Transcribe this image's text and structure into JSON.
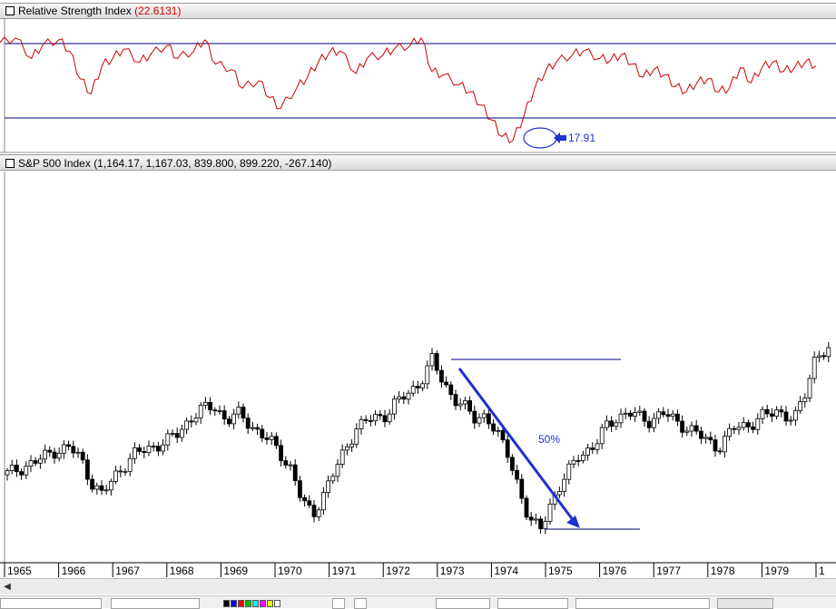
{
  "colors": {
    "rsi_line": "#cc0000",
    "reference_line": "#000080",
    "annotation": "#1f2fd0",
    "candle": "#000000",
    "rsi_value_text": "#d00000"
  },
  "rsi_pane": {
    "title": "Relative Strength Index",
    "value": "(22.6131)",
    "low_callout": "17.91"
  },
  "price_pane": {
    "title": "S&P 500 Index",
    "ohlc": "(1,164.17, 1,167.03, 839.800, 899.220, -267.140)",
    "annotation": "50%"
  },
  "x_axis": {
    "labels": [
      "1965",
      "1966",
      "1967",
      "1968",
      "1969",
      "1970",
      "1971",
      "1972",
      "1973",
      "1974",
      "1975",
      "1976",
      "1977",
      "1978",
      "1979",
      "1"
    ]
  },
  "chart_data": [
    {
      "type": "line",
      "title": "Relative Strength Index",
      "x_range": [
        1965,
        1980
      ],
      "reference_levels": [
        70,
        30
      ],
      "min_marked": 17.91,
      "series": [
        {
          "name": "Relative Strength Index",
          "x": [
            1964.9,
            1965.2,
            1965.5,
            1965.7,
            1966.0,
            1966.2,
            1966.4,
            1966.6,
            1966.8,
            1967.0,
            1967.2,
            1967.5,
            1967.7,
            1968.0,
            1968.2,
            1968.5,
            1968.7,
            1968.9,
            1969.2,
            1969.4,
            1969.7,
            1969.9,
            1970.1,
            1970.4,
            1970.6,
            1970.8,
            1971.0,
            1971.2,
            1971.5,
            1971.7,
            1972.0,
            1972.2,
            1972.5,
            1972.7,
            1972.9,
            1973.1,
            1973.4,
            1973.6,
            1973.8,
            1974.0,
            1974.2,
            1974.4,
            1974.6,
            1974.8,
            1975.0,
            1975.2,
            1975.5,
            1975.7,
            1976.0,
            1976.2,
            1976.4,
            1976.6,
            1976.8,
            1977.0,
            1977.2,
            1977.4,
            1977.6,
            1977.8,
            1978.0,
            1978.2,
            1978.4,
            1978.6,
            1978.8,
            1979.0,
            1979.2,
            1979.4,
            1979.6,
            1979.8,
            1980.0
          ],
          "values": [
            70,
            73,
            62,
            69,
            72,
            66,
            51,
            43,
            58,
            62,
            67,
            60,
            64,
            69,
            62,
            66,
            72,
            59,
            56,
            46,
            50,
            41,
            35,
            46,
            52,
            60,
            65,
            66,
            54,
            62,
            64,
            67,
            69,
            73,
            55,
            53,
            48,
            44,
            37,
            29,
            20,
            18,
            31,
            46,
            55,
            60,
            64,
            66,
            62,
            61,
            64,
            59,
            52,
            56,
            53,
            47,
            44,
            49,
            51,
            44,
            46,
            57,
            49,
            57,
            60,
            55,
            57,
            60,
            58
          ]
        }
      ]
    },
    {
      "type": "candlestick",
      "title": "S&P 500 Index",
      "x_range": [
        1965,
        1980
      ],
      "y_range": [
        60,
        125
      ],
      "series": [
        {
          "name": "S&P 500 Index",
          "x": [
            1965.0,
            1965.3,
            1965.6,
            1965.9,
            1966.2,
            1966.4,
            1966.6,
            1966.8,
            1967.1,
            1967.4,
            1967.7,
            1968.0,
            1968.2,
            1968.4,
            1968.6,
            1968.9,
            1969.1,
            1969.3,
            1969.6,
            1969.9,
            1970.1,
            1970.3,
            1970.5,
            1970.7,
            1971.0,
            1971.2,
            1971.5,
            1971.7,
            1972.0,
            1972.2,
            1972.5,
            1972.7,
            1972.9,
            1973.1,
            1973.3,
            1973.5,
            1973.7,
            1973.9,
            1974.1,
            1974.3,
            1974.5,
            1974.7,
            1974.9,
            1975.1,
            1975.4,
            1975.6,
            1975.9,
            1976.1,
            1976.3,
            1976.6,
            1976.9,
            1977.2,
            1977.5,
            1977.8,
            1978.0,
            1978.2,
            1978.5,
            1978.8,
            1979.0,
            1979.3,
            1979.6,
            1979.8,
            1980.0
          ],
          "close": [
            84,
            86,
            88,
            91,
            92,
            89,
            82,
            78,
            85,
            90,
            92,
            94,
            96,
            100,
            103,
            104,
            100,
            102,
            98,
            94,
            90,
            86,
            76,
            72,
            82,
            88,
            98,
            100,
            101,
            105,
            108,
            112,
            118,
            111,
            107,
            104,
            100,
            102,
            96,
            90,
            81,
            70,
            68,
            76,
            84,
            90,
            92,
            98,
            101,
            102,
            100,
            102,
            99,
            96,
            94,
            92,
            98,
            99,
            101,
            103,
            100,
            108,
            120
          ]
        }
      ]
    }
  ]
}
